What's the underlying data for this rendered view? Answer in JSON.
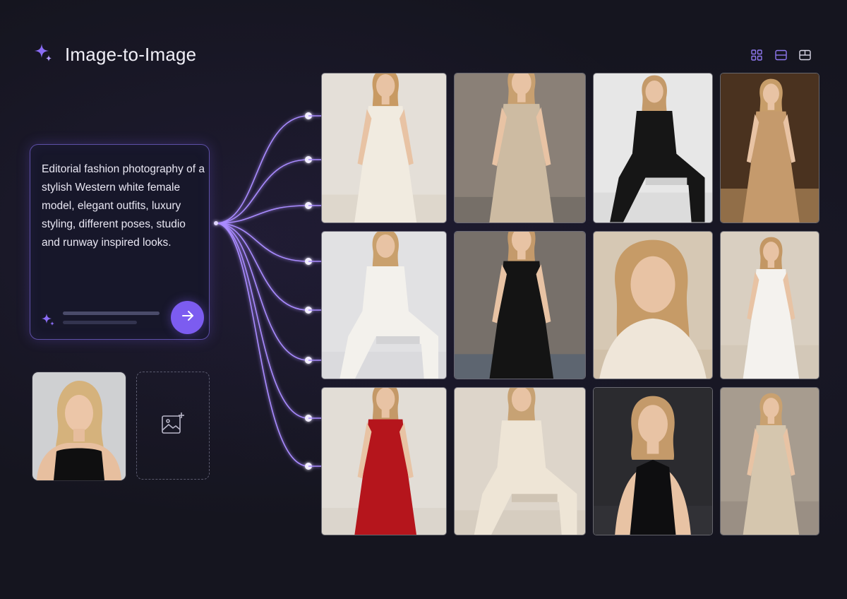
{
  "header": {
    "title": "Image-to-Image",
    "icon": "sparkle-icon"
  },
  "toolbar": {
    "views": [
      "grid-view-icon",
      "row-view-icon",
      "split-view-icon"
    ]
  },
  "prompt": {
    "text": "Editorial fashion photography of a stylish Western white female model, elegant outfits, luxury styling, different poses, studio and runway inspired looks.",
    "send_icon": "arrow-right-icon"
  },
  "reference": {
    "icon": "portrait-photo"
  },
  "upload": {
    "icon": "add-image-icon"
  },
  "colors": {
    "accent": "#7c5cf0",
    "background": "#15151f",
    "card_border": "#5d4fa6"
  },
  "results": [
    {
      "name": "result-white-dress",
      "bg": "#e4dfd8",
      "outfit": "#f1ebe0",
      "pose": "stand",
      "hair": "#c89a63",
      "accent": "#d8cfbf"
    },
    {
      "name": "result-trench-street",
      "bg": "#8a8077",
      "outfit": "#cdbba2",
      "pose": "stand",
      "hair": "#c8a070",
      "accent": "#5e5a57"
    },
    {
      "name": "result-black-suit",
      "bg": "#e7e7e7",
      "outfit": "#161616",
      "pose": "sit",
      "hair": "#c49a6a",
      "accent": "#cfcfcf"
    },
    {
      "name": "result-gold-gown-runway",
      "bg": "#4a321f",
      "outfit": "#c59a6c",
      "pose": "stand",
      "hair": "#c79d69",
      "accent": "#e8b87a"
    },
    {
      "name": "result-white-suit-seated",
      "bg": "#e1e1e3",
      "outfit": "#f3f1ec",
      "pose": "sit",
      "hair": "#c9a06d",
      "accent": "#d3d3d5"
    },
    {
      "name": "result-leather-jacket-street",
      "bg": "#77706a",
      "outfit": "#141414",
      "pose": "stand",
      "hair": "#c49a6b",
      "accent": "#3e5877"
    },
    {
      "name": "result-knit-portrait",
      "bg": "#d6c8b4",
      "outfit": "#efe6d9",
      "pose": "close",
      "hair": "#c69b67",
      "accent": "#c9b59c"
    },
    {
      "name": "result-white-bustier",
      "bg": "#d9cfc1",
      "outfit": "#f4f2ee",
      "pose": "stand",
      "hair": "#c39764",
      "accent": "#cbbfae"
    },
    {
      "name": "result-red-gown",
      "bg": "#e2ddd6",
      "outfit": "#b5151c",
      "pose": "stand",
      "hair": "#c49968",
      "accent": "#d3cbc1"
    },
    {
      "name": "result-cream-suit-seated",
      "bg": "#ddd5ca",
      "outfit": "#eee5d6",
      "pose": "sit",
      "hair": "#c7a274",
      "accent": "#cfc4b4"
    },
    {
      "name": "result-black-halter",
      "bg": "#2b2b2f",
      "outfit": "#0e0e10",
      "pose": "half",
      "hair": "#c49a6a",
      "accent": "#3a3a40"
    },
    {
      "name": "result-trench-sunglasses",
      "bg": "#a79c8f",
      "outfit": "#d5c6ae",
      "pose": "stand",
      "hair": "#c9a170",
      "accent": "#8b8178"
    }
  ]
}
